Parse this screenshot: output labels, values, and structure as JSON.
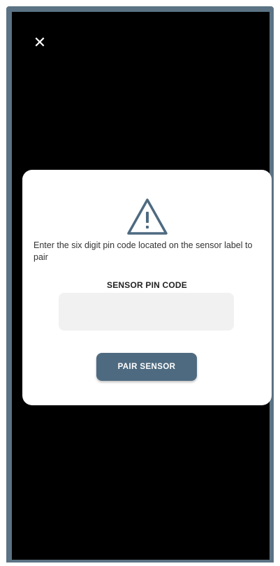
{
  "close": {
    "icon": "close-icon",
    "glyph": "✕"
  },
  "modal": {
    "icon": "warning-triangle-icon",
    "message": "Enter the six digit pin code located on the sensor label to pair",
    "pin_label": "SENSOR PIN CODE",
    "pin_value": "",
    "pin_placeholder": "",
    "pair_button": "PAIR SENSOR"
  },
  "colors": {
    "frame": "#5b7384",
    "accent": "#4e6a80",
    "background": "#000000",
    "modal": "#ffffff",
    "input": "#f1f1f1"
  }
}
